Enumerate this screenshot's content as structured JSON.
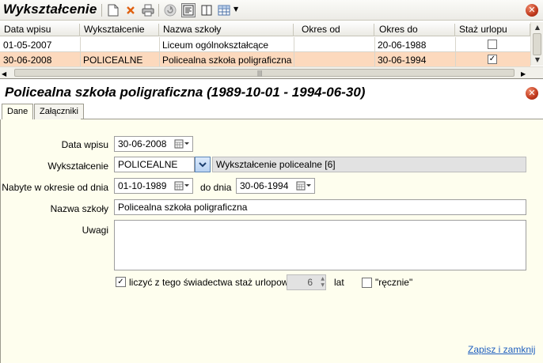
{
  "toolbar": {
    "title": "Wykształcenie"
  },
  "grid": {
    "columns": [
      "Data wpisu",
      "Wykształcenie",
      "Nazwa szkoły",
      "Okres od",
      "Okres do",
      "Staż urlopu"
    ],
    "rows": [
      {
        "data_wpisu": "01-05-2007",
        "wyksztalcenie": "",
        "nazwa": "Liceum ogólnokształcące",
        "okres_od": "",
        "okres_do": "20-06-1988",
        "staz": false
      },
      {
        "data_wpisu": "30-06-2008",
        "wyksztalcenie": "POLICEALNE",
        "nazwa": "Policealna szkoła poligraficzna",
        "okres_od": "",
        "okres_do": "30-06-1994",
        "staz": true
      }
    ],
    "selected_row": 1
  },
  "detail": {
    "title": "Policealna szkoła poligraficzna (1989-10-01 - 1994-06-30)",
    "tabs": [
      "Dane",
      "Załączniki"
    ],
    "active_tab": 0
  },
  "form": {
    "data_wpisu_label": "Data wpisu",
    "data_wpisu_value": "30-06-2008",
    "wyksztalcenie_label": "Wykształcenie",
    "wyksztalcenie_value": "POLICEALNE",
    "wyksztalcenie_desc": "Wykształcenie policealne [6]",
    "okres_od_label": "Nabyte w okresie od dnia",
    "okres_od_value": "01-10-1989",
    "okres_do_label": "do dnia",
    "okres_do_value": "30-06-1994",
    "nazwa_label": "Nazwa szkoły",
    "nazwa_value": "Policealna szkoła poligraficzna",
    "uwagi_label": "Uwagi",
    "uwagi_value": "",
    "staz_checkbox_label": "liczyć z tego świadectwa staż urlopowy",
    "staz_checked": true,
    "staz_years": "6",
    "staz_unit": "lat",
    "recznie_label": "\"ręcznie\"",
    "recznie_checked": false,
    "save_link": "Zapisz i zamknij"
  },
  "colors": {
    "selected_row": "#fcd9bd",
    "panel_bg": "#fefeee",
    "link": "#1f5fbf",
    "close": "#c0391d"
  }
}
